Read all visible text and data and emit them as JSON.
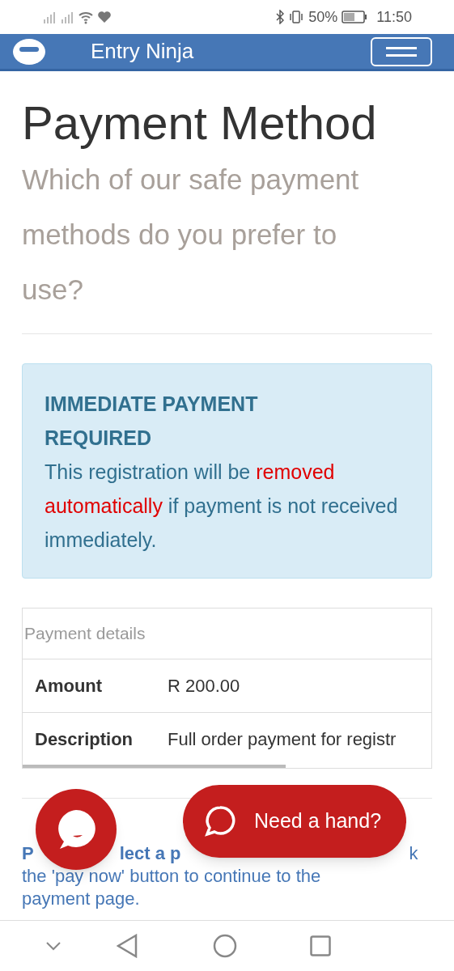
{
  "status_bar": {
    "battery": "50%",
    "time": "11:50"
  },
  "header": {
    "brand": "Entry Ninja"
  },
  "page": {
    "title": "Payment Method",
    "subtitle": "Which of our safe payment methods do you prefer to use?"
  },
  "alert": {
    "heading": "IMMEDIATE PAYMENT REQUIRED",
    "message": "This registration will be **removed automatically** if payment is not received immediately."
  },
  "table": {
    "caption": "Payment details",
    "rows": [
      {
        "label": "Amount",
        "value": "R 200.00"
      },
      {
        "label": "Description",
        "value": "Full order payment for registr"
      }
    ]
  },
  "instructions": {
    "line_1_fragments": [
      "P",
      "lect a p",
      "k"
    ],
    "line_2": "the 'pay now' button to continue to the",
    "line_3": "payment page."
  },
  "chat": {
    "button": "Need a hand?"
  }
}
